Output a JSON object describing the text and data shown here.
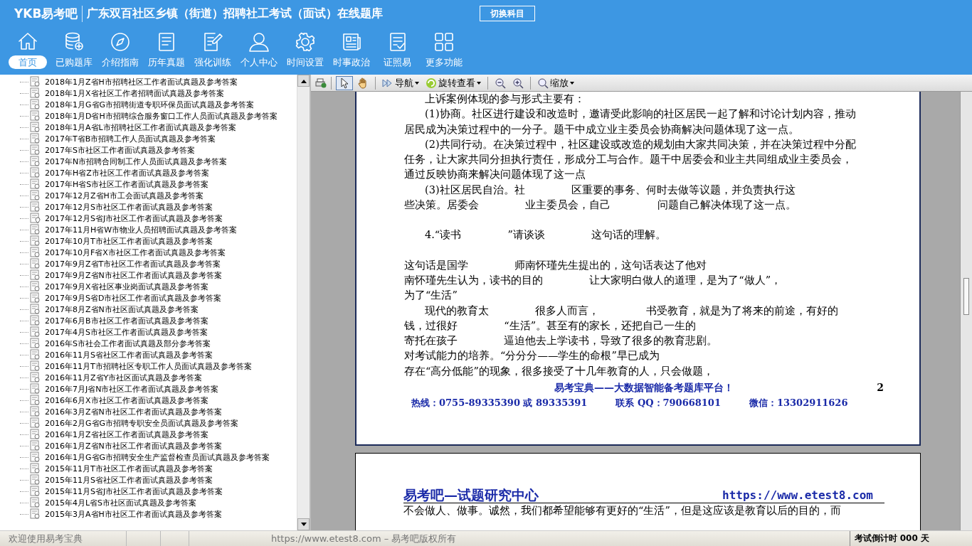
{
  "header": {
    "app_name": "YKB易考吧",
    "title": "广东双百社区乡镇（街道）招聘社工考试（面试）在线题库",
    "switch_button": "切换科目"
  },
  "nav": [
    {
      "label": "首页",
      "selected": true
    },
    {
      "label": "已购题库",
      "selected": false
    },
    {
      "label": "介绍指南",
      "selected": false
    },
    {
      "label": "历年真题",
      "selected": false
    },
    {
      "label": "强化训练",
      "selected": false
    },
    {
      "label": "个人中心",
      "selected": false
    },
    {
      "label": "时间设置",
      "selected": false
    },
    {
      "label": "时事政治",
      "selected": false
    },
    {
      "label": "证照易",
      "selected": false
    },
    {
      "label": "更多功能",
      "selected": false
    }
  ],
  "tree": [
    {
      "label": "2018年1月Z省H市招聘社区工作者面试真题及参考答案",
      "kind": "doc"
    },
    {
      "label": "2018年1月X省社区工作者招聘面试真题及参考答案",
      "kind": "doc"
    },
    {
      "label": "2018年1月G省G市招聘街道专职环保员面试真题及参考答案",
      "kind": "doc"
    },
    {
      "label": "2018年1月D省H市招聘综合服务窗口工作人员面试真题及参考答案",
      "kind": "doc"
    },
    {
      "label": "2018年1月A省L市招聘社区工作者面试真题及参考答案",
      "kind": "doc"
    },
    {
      "label": "2017年T省B市招聘工作人员面试真题及参考答案",
      "kind": "doc"
    },
    {
      "label": "2017年S市社区工作者面试真题及参考答案",
      "kind": "doc"
    },
    {
      "label": "2017年N市招聘合同制工作人员面试真题及参考答案",
      "kind": "doc"
    },
    {
      "label": "2017年H省Z市社区工作者面试真题及参考答案",
      "kind": "doc"
    },
    {
      "label": "2017年H省S市社区工作者面试真题及参考答案",
      "kind": "doc"
    },
    {
      "label": "2017年12月Z省H市工会面试真题及参考答案",
      "kind": "doc"
    },
    {
      "label": "2017年12月S市社区工作者面试真题及参考答案",
      "kind": "doc"
    },
    {
      "label": "2017年12月S省J市社区工作者面试真题及参考答案",
      "kind": "pin"
    },
    {
      "label": "2017年11月H省W市物业人员招聘面试真题及参考答案",
      "kind": "doc"
    },
    {
      "label": "2017年10月T市社区工作者面试真题及参考答案",
      "kind": "doc"
    },
    {
      "label": "2017年10月F省X市社区工作者面试真题及参考答案",
      "kind": "doc"
    },
    {
      "label": "2017年9月Z省T市社区工作者面试真题及参考答案",
      "kind": "doc"
    },
    {
      "label": "2017年9月Z省N市社区工作者面试真题及参考答案",
      "kind": "doc"
    },
    {
      "label": "2017年9月X省社区事业岗面试真题及参考答案",
      "kind": "doc"
    },
    {
      "label": "2017年9月S省D市社区工作者面试真题及参考答案",
      "kind": "doc"
    },
    {
      "label": "2017年8月Z省N市社区面试真题及参考答案",
      "kind": "doc"
    },
    {
      "label": "2017年6月B市社区工作者面试真题及参考答案",
      "kind": "doc"
    },
    {
      "label": "2017年4月S市社区工作者面试真题及参考答案",
      "kind": "doc"
    },
    {
      "label": "2016年S市社会工作者面试真题及部分参考答案",
      "kind": "doc"
    },
    {
      "label": "2016年11月S省社区工作者面试真题及参考答案",
      "kind": "doc"
    },
    {
      "label": "2016年11月T市招聘社区专职工作人员面试真题及参考答案",
      "kind": "doc"
    },
    {
      "label": "2016年11月Z省Y市社区面试真题及参考答案",
      "kind": "doc"
    },
    {
      "label": "2016年7月J省N市社区工作者面试真题及参考答案",
      "kind": "doc"
    },
    {
      "label": "2016年6月X市社区工作者面试真题及参考答案",
      "kind": "doc"
    },
    {
      "label": "2016年3月Z省N市社区工作者面试真题及参考答案",
      "kind": "doc"
    },
    {
      "label": "2016年2月G省G市招聘专职安全员面试真题及参考答案",
      "kind": "doc"
    },
    {
      "label": "2016年1月Z省社区工作者面试真题及参考答案",
      "kind": "doc"
    },
    {
      "label": "2016年1月Z省N市社区工作者面试真题及参考答案",
      "kind": "doc"
    },
    {
      "label": "2016年1月G省G市招聘安全生产监督检查员面试真题及参考答案",
      "kind": "doc"
    },
    {
      "label": "2015年11月T市社区工作者面试真题及参考答案",
      "kind": "doc"
    },
    {
      "label": "2015年11月S省社区工作者面试真题及参考答案",
      "kind": "doc"
    },
    {
      "label": "2015年11月S省J市社区工作者面试真题及参考答案",
      "kind": "doc"
    },
    {
      "label": "2015年4月L省S市社区面试真题及参考答案",
      "kind": "doc"
    },
    {
      "label": "2015年3月A省H市社区工作者面试真题及参考答案",
      "kind": "doc"
    }
  ],
  "toolbar": {
    "navigate": "导航",
    "rotate": "旋转查看",
    "zoom": "缩放"
  },
  "page1": {
    "lines": [
      {
        "kind": "first",
        "parts": [
          "上诉案例体现的参与形式主要有："
        ]
      },
      {
        "kind": "first",
        "parts": [
          "(1)协商。社区进行建设和改造时，邀请受此影响的社区居民一起了解和讨论计划内容，推动"
        ]
      },
      {
        "kind": "cont",
        "parts": [
          "居民成为决策过程中的一分子。题干中成立业主委员会协商解决问题体现了这一点。"
        ]
      },
      {
        "kind": "first",
        "parts": [
          "(2)共同行动。在决策过程中，社区建设或改造的规划由大家共同决策，并在决策过程中分配"
        ]
      },
      {
        "kind": "cont",
        "parts": [
          "任务，让大家共同分担执行责任，形成分工与合作。题干中居委会和业主共同组成业主委员会，"
        ]
      },
      {
        "kind": "cont",
        "parts": [
          "通过反映协商来解决问题体现了这一点"
        ]
      },
      {
        "kind": "first",
        "parts": [
          "(3)社区居民自治。社",
          "区重要的事务、何时去做等议题，并负责执行这"
        ]
      },
      {
        "kind": "cont",
        "parts": [
          "些决策。居委会",
          "业主委员会，自己",
          "问题自己解决体现了这一点。"
        ]
      },
      {
        "kind": "gap"
      },
      {
        "kind": "first",
        "parts": [
          "4.“读书",
          "”请谈谈",
          "这句话的理解。"
        ]
      },
      {
        "kind": "gap"
      },
      {
        "kind": "cont",
        "parts": [
          "这句话是国学",
          "师南怀瑾先生提出的，这句话表达了他对"
        ]
      },
      {
        "kind": "cont",
        "parts": [
          "南怀瑾先生认为，读书的目的",
          "让大家明白做人的道理，是为了“做人”，"
        ]
      },
      {
        "kind": "cont",
        "parts": [
          "为了“生活”"
        ]
      },
      {
        "kind": "first",
        "parts": [
          "现代的教育太",
          "很多人而言，",
          "书受教育，就是为了将来的前途，有好的"
        ]
      },
      {
        "kind": "cont",
        "parts": [
          "钱，过很好",
          "“生活”。甚至有的家长，还把自己一生的"
        ]
      },
      {
        "kind": "cont",
        "parts": [
          "寄托在孩子",
          "逼迫他去上学读书，导致了很多的教育悲剧。"
        ]
      },
      {
        "kind": "cont",
        "parts": [
          "对考试能力的培养。“分分分——学生的命根”早已成为"
        ]
      },
      {
        "kind": "cont",
        "parts": [
          "存在“高分低能”的现象，很多接受了十几年教育的人，只会做题，"
        ]
      }
    ],
    "footer_slogan": "易考宝典——大数据智能备考题库平台！",
    "page_number": "2",
    "hotline": "热线：0755-89335390 或 89335391",
    "qq": "联系 QQ：790668101",
    "wechat": "微信：13302911626"
  },
  "page2": {
    "heading": "易考吧—试题研究中心",
    "url": "https://www.etest8.com",
    "lines": [
      "不会做人、做事。诚然，我们都希望能够有更好的“生活”，但是这应该是教育以后的目的，而"
    ]
  },
  "status_bar": {
    "welcome": "欢迎使用易考宝典",
    "copyright": "https://www.etest8.com – 易考吧版权所有",
    "countdown": "考试倒计时 000 天"
  }
}
